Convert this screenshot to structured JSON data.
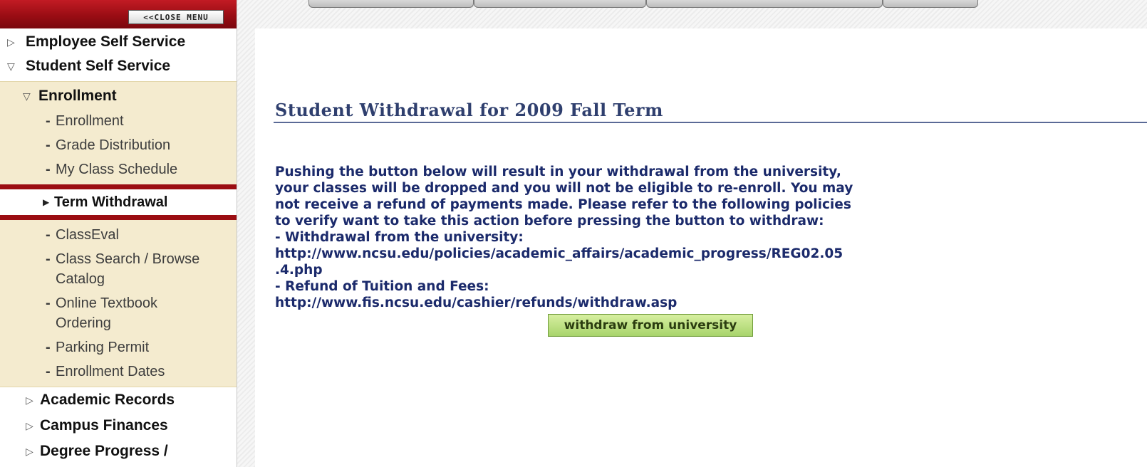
{
  "menu": {
    "close_label": "<<CLOSE MENU",
    "top_items": [
      {
        "label": "Employee Self Service",
        "expanded": false
      },
      {
        "label": "Student Self Service",
        "expanded": true
      }
    ],
    "enrollment_group": {
      "label": "Enrollment",
      "items_before": [
        "Enrollment",
        "Grade Distribution",
        "My Class Schedule"
      ],
      "active_item": "Term Withdrawal",
      "items_after": [
        {
          "line1": "ClassEval",
          "line2": ""
        },
        {
          "line1": "Class Search / Browse",
          "line2": "Catalog"
        },
        {
          "line1": "Online Textbook",
          "line2": "Ordering"
        },
        {
          "line1": "Parking Permit",
          "line2": ""
        },
        {
          "line1": "Enrollment Dates",
          "line2": ""
        }
      ]
    },
    "sections": [
      "Academic Records",
      "Campus Finances",
      "Degree Progress /"
    ]
  },
  "main": {
    "title": "Student Withdrawal for 2009 Fall Term",
    "message_lines": [
      "Pushing the button below will result in your withdrawal from the university,",
      "your classes will be dropped and you will not be eligible to re-enroll. You may",
      "not receive a refund of payments made. Please refer to the following policies",
      "to verify want to take this action before pressing the button to withdraw:",
      "- Withdrawal from the university:",
      "http://www.ncsu.edu/policies/academic_affairs/academic_progress/REG02.05",
      ".4.php",
      "- Refund of Tuition and Fees:",
      "http://www.fis.ncsu.edu/cashier/refunds/withdraw.asp"
    ],
    "button_label": "withdraw from university"
  },
  "colors": {
    "brand_red": "#9b0d12",
    "title_blue": "#2f3f6e",
    "text_blue": "#1b2a6b",
    "button_green": "#a8d46c",
    "sidebar_highlight": "#f4ebcf"
  },
  "icons": {
    "collapsed": "triangle-right-outline-icon",
    "expanded": "triangle-down-outline-icon",
    "bullet": "dash-bullet-icon",
    "active": "triangle-right-filled-icon"
  }
}
